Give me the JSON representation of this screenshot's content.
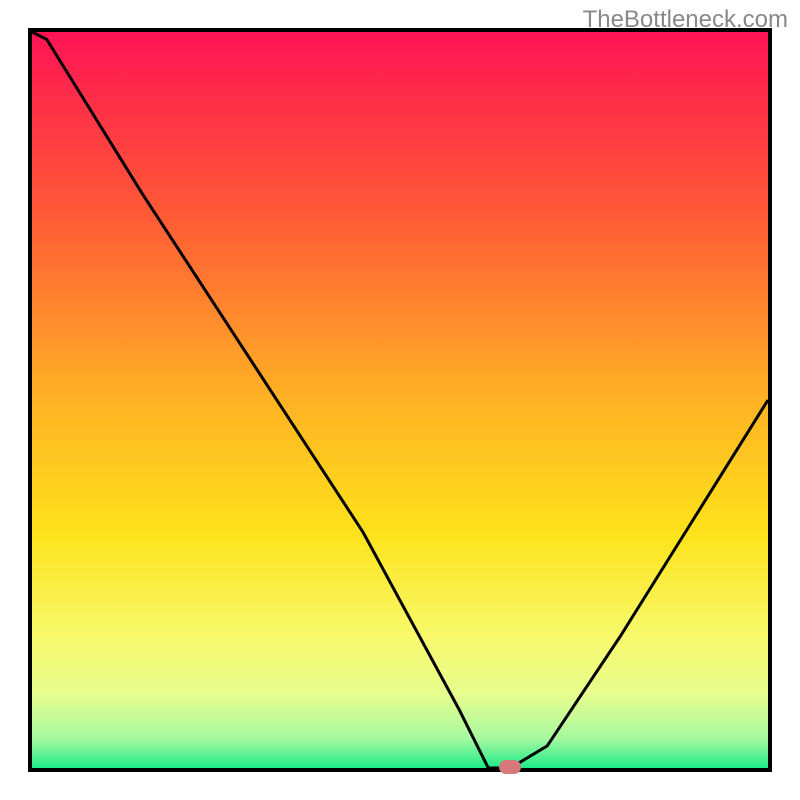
{
  "chart_data": {
    "type": "line",
    "watermark": "TheBottleneck.com",
    "title": "",
    "xlabel": "",
    "ylabel": "",
    "x": [
      0,
      2,
      15,
      30,
      45,
      58,
      62,
      65,
      70,
      80,
      90,
      100
    ],
    "values": [
      100,
      99,
      78,
      55,
      32,
      8,
      0,
      0,
      3,
      18,
      34,
      50
    ],
    "xlim": [
      0,
      100
    ],
    "ylim": [
      0,
      100
    ],
    "marker": {
      "x": 65,
      "y": 0
    },
    "gradient_stops": [
      {
        "offset": 0,
        "color": "#ff1455"
      },
      {
        "offset": 25,
        "color": "#ff5a35"
      },
      {
        "offset": 50,
        "color": "#ffb224"
      },
      {
        "offset": 68,
        "color": "#fde21a"
      },
      {
        "offset": 82,
        "color": "#f8f96a"
      },
      {
        "offset": 90,
        "color": "#e7fd8e"
      },
      {
        "offset": 96,
        "color": "#a6f9a0"
      },
      {
        "offset": 100,
        "color": "#1eea88"
      }
    ]
  }
}
